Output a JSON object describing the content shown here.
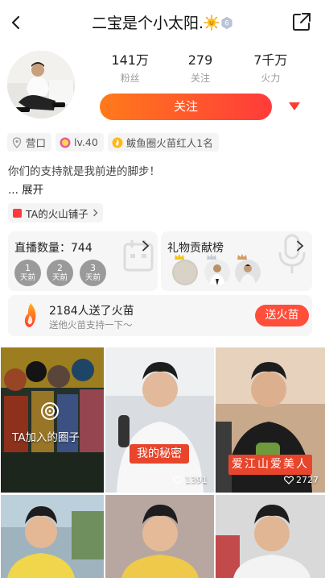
{
  "header": {
    "title": "二宝是个小太阳.",
    "level_badge": "6",
    "back_icon": "chevron-left-icon",
    "share_icon": "share-external-icon"
  },
  "profile": {
    "stats": [
      {
        "value": "141万",
        "label": "粉丝"
      },
      {
        "value": "279",
        "label": "关注"
      },
      {
        "value": "7千万",
        "label": "火力"
      }
    ],
    "follow_label": "关注",
    "tags": [
      {
        "icon": "location-pin-icon",
        "text": "营口"
      },
      {
        "icon": "level-badge-icon",
        "text": "lv.40"
      },
      {
        "icon": "fire-rank-icon",
        "text": "鲅鱼圈火苗红人1名"
      }
    ],
    "bio": "你们的支持就是我前进的脚步！",
    "expand_label": "... 展开",
    "shop_label": "TA的火山铺子"
  },
  "live_card": {
    "title": "直播数量：744",
    "days": [
      {
        "num": "1",
        "unit": "天前"
      },
      {
        "num": "2",
        "unit": "天前"
      },
      {
        "num": "3",
        "unit": "天前"
      }
    ]
  },
  "gift_card": {
    "title": "礼物贡献榜"
  },
  "fire_card": {
    "headline": "2184人送了火苗",
    "subline": "送他火苗支持一下～",
    "button_label": "送火苗"
  },
  "grid": {
    "circle_label": "TA加入的圈子",
    "items": [
      {
        "overlay": "我的秘密",
        "likes": "1391"
      },
      {
        "overlay": "爱江山爱美人",
        "likes": "2727"
      }
    ]
  },
  "colors": {
    "accent_gradient_start": "#ff7a1a",
    "accent_gradient_end": "#ff3b3b",
    "fire_button": "#ff4e3a"
  }
}
